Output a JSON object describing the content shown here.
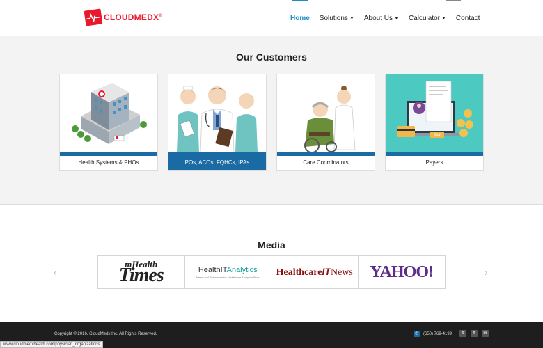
{
  "brand": {
    "name_part1": "CLOUD",
    "name_part2": "MEDX",
    "trademark": "®"
  },
  "nav": [
    {
      "label": "Home",
      "active": true
    },
    {
      "label": "Solutions",
      "dropdown": true
    },
    {
      "label": "About Us",
      "dropdown": true
    },
    {
      "label": "Calculator",
      "dropdown": true
    },
    {
      "label": "Contact"
    }
  ],
  "customers": {
    "title": "Our Customers",
    "cards": [
      {
        "label": "Health Systems & PHOs",
        "icon": "hospital-illustration"
      },
      {
        "label": "POs, ACOs, FQHCs, IPAs",
        "icon": "doctors-illustration",
        "selected": true
      },
      {
        "label": "Care Coordinators",
        "icon": "caregiver-illustration"
      },
      {
        "label": "Payers",
        "icon": "payment-illustration",
        "pay_label": "PAY"
      }
    ]
  },
  "media": {
    "title": "Media",
    "logos": [
      {
        "line1": "mHealth",
        "line2": "Times"
      },
      {
        "part1": "HealthIT",
        "part2": "Analytics",
        "tagline": "News and Resources for Healthcare Analytics Pros"
      },
      {
        "part1": "Healthcare",
        "part2": "IT",
        "part3": "News"
      },
      {
        "text": "YAHOO!"
      }
    ],
    "prev_arrow": "‹",
    "next_arrow": "›"
  },
  "footer": {
    "copyright": "Copyright © 2016, CloudMedx Inc. All Rights Reserved.",
    "phone": "(650) 769-4199",
    "social": [
      "twitter-icon",
      "facebook-icon",
      "linkedin-icon"
    ]
  },
  "status_url": "www.cloudmedxhealth.com/physician_organizations",
  "colors": {
    "accent": "#1a8fc4",
    "card_bar": "#1a6aa4",
    "brand_red": "#e8192c"
  }
}
